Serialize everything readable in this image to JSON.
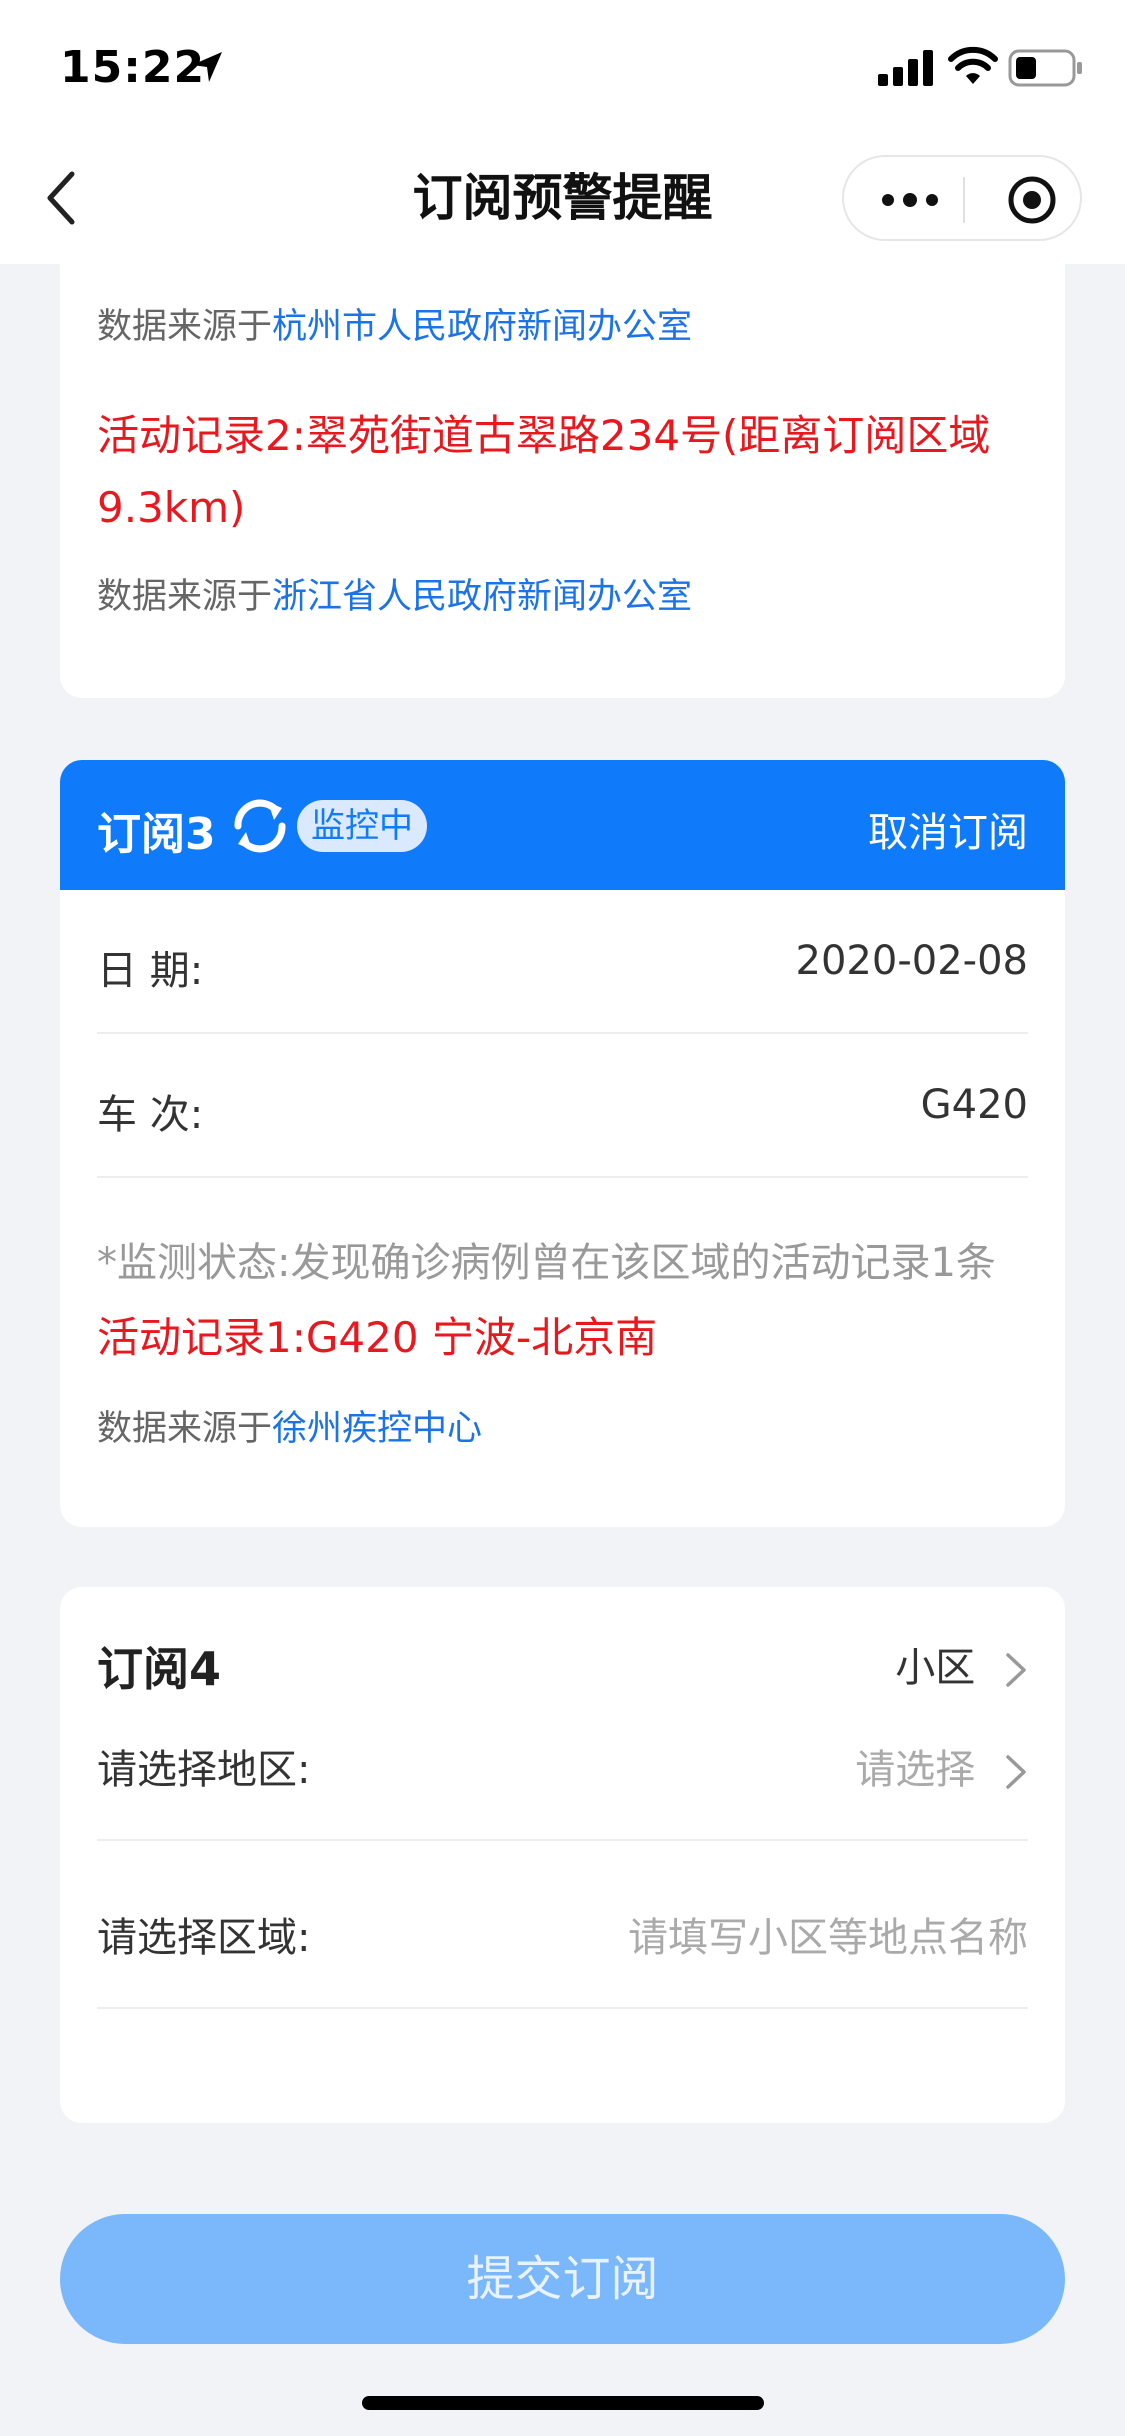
{
  "status_bar": {
    "time": "15:22"
  },
  "nav": {
    "title": "订阅预警提醒"
  },
  "colors": {
    "primary": "#0f7bfa",
    "alert": "#e8181e",
    "link": "#1a73e8",
    "submit_disabled": "#7ab8fb"
  },
  "card1": {
    "source1_prefix": "数据来源于",
    "source1_link": "杭州市人民政府新闻办公室",
    "record2": "活动记录2:翠苑街道古翠路234号(距离订阅区域9.3km)",
    "source2_prefix": "数据来源于",
    "source2_link": "浙江省人民政府新闻办公室"
  },
  "sub3": {
    "title": "订阅3",
    "badge": "监控中",
    "cancel_label": "取消订阅",
    "date_label": "日 期:",
    "date_value": "2020-02-08",
    "train_label": "车 次:",
    "train_value": "G420",
    "monitor_status": "*监测状态:发现确诊病例曾在该区域的活动记录1条",
    "record1": "活动记录1:G420 宁波-北京南",
    "source_prefix": "数据来源于",
    "source_link": "徐州疾控中心"
  },
  "sub4": {
    "title": "订阅4",
    "type_value": "小区",
    "region_label": "请选择地区:",
    "region_placeholder": "请选择",
    "area_label": "请选择区域:",
    "area_placeholder": "请填写小区等地点名称"
  },
  "submit_label": "提交订阅",
  "icons": {
    "location": "location-arrow-icon",
    "signal": "cellular-signal-icon",
    "wifi": "wifi-icon",
    "battery": "battery-icon",
    "back": "back-chevron-icon",
    "more": "more-dots-icon",
    "close_target": "target-circle-icon",
    "refresh": "refresh-icon",
    "chevron": "chevron-right-icon"
  }
}
